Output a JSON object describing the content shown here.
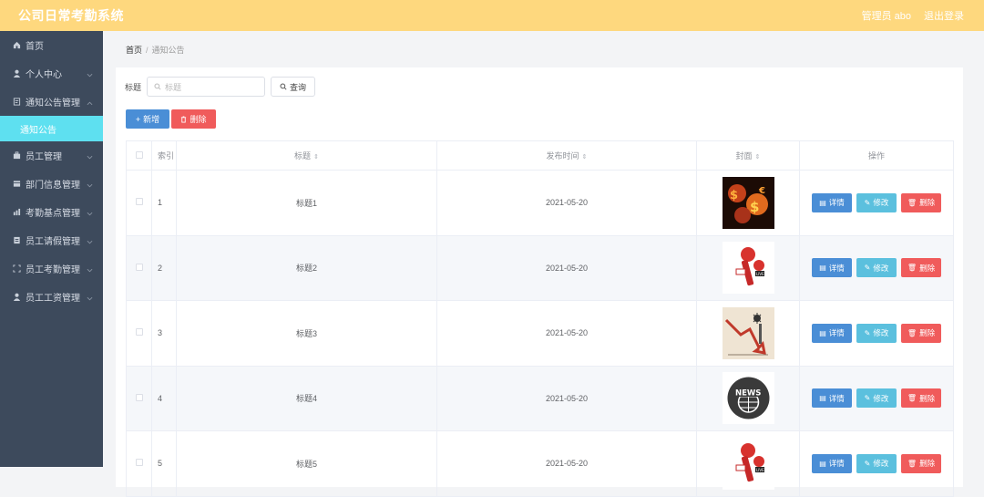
{
  "app": {
    "title": "公司日常考勤系统"
  },
  "topbar": {
    "user_label": "管理员 abo",
    "logout_label": "退出登录"
  },
  "sidebar": {
    "items": [
      {
        "label": "首页",
        "icon": "home-icon"
      },
      {
        "label": "个人中心",
        "icon": "user-icon"
      },
      {
        "label": "通知公告管理",
        "icon": "notice-icon"
      },
      {
        "label": "员工管理",
        "icon": "staff-icon"
      },
      {
        "label": "部门信息管理",
        "icon": "department-icon"
      },
      {
        "label": "考勤基点管理",
        "icon": "chart-icon"
      },
      {
        "label": "员工请假管理",
        "icon": "leave-icon"
      },
      {
        "label": "员工考勤管理",
        "icon": "attendance-icon"
      },
      {
        "label": "员工工资管理",
        "icon": "salary-icon"
      }
    ],
    "active_sub": "通知公告"
  },
  "breadcrumb": {
    "home": "首页",
    "sep": "/",
    "current": "通知公告"
  },
  "search": {
    "label": "标题",
    "placeholder": "标题",
    "query_button": "查询"
  },
  "actions": {
    "add_label": "新增",
    "delete_label": "删除"
  },
  "table": {
    "columns": {
      "index": "索引",
      "title": "标题",
      "published": "发布时间",
      "cover": "封面",
      "ops": "操作"
    },
    "op_labels": {
      "detail": "详情",
      "edit": "修改",
      "remove": "删除"
    },
    "rows": [
      {
        "index": "1",
        "title": "标题1",
        "published": "2021-05-20",
        "cover": "finance-cover"
      },
      {
        "index": "2",
        "title": "标题2",
        "published": "2021-05-20",
        "cover": "live-mic-cover"
      },
      {
        "index": "3",
        "title": "标题3",
        "published": "2021-05-20",
        "cover": "chart-down-cover"
      },
      {
        "index": "4",
        "title": "标题4",
        "published": "2021-05-20",
        "cover": "news-globe-cover"
      },
      {
        "index": "5",
        "title": "标题5",
        "published": "2021-05-20",
        "cover": "live-mic-cover"
      }
    ]
  },
  "colors": {
    "topbar": "#fed87e",
    "sidebar": "#3d4a5c",
    "active": "#5ee0f0",
    "primary": "#4a8ed6",
    "info": "#5bc0de",
    "danger": "#f05b5b"
  }
}
